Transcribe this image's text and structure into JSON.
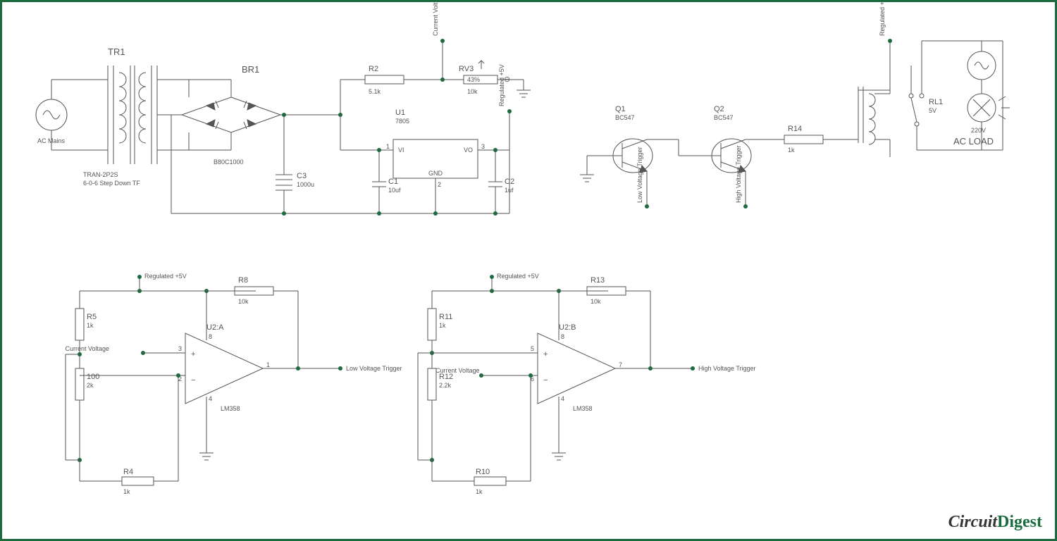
{
  "components": {
    "TR1": {
      "ref": "TR1",
      "type": "TRAN-2P2S",
      "note": "6-0-6 Step Down TF"
    },
    "AC": {
      "label": "AC Mains"
    },
    "BR1": {
      "ref": "BR1",
      "type": "B80C1000"
    },
    "C3": {
      "ref": "C3",
      "val": "1000u"
    },
    "C1": {
      "ref": "C1",
      "val": "10uf"
    },
    "C2": {
      "ref": "C2",
      "val": "1uf"
    },
    "R2": {
      "ref": "R2",
      "val": "5.1k"
    },
    "RV3": {
      "ref": "RV3",
      "val": "10k",
      "pct": "43%"
    },
    "U1": {
      "ref": "U1",
      "type": "7805",
      "pins": {
        "vi": "VI",
        "vo": "VO",
        "gnd": "GND",
        "p1": "1",
        "p2": "2",
        "p3": "3"
      }
    },
    "Q1": {
      "ref": "Q1",
      "type": "BC547"
    },
    "Q2": {
      "ref": "Q2",
      "type": "BC547"
    },
    "R14": {
      "ref": "R14",
      "val": "1k"
    },
    "RL1": {
      "ref": "RL1",
      "val": "5V"
    },
    "LOAD": {
      "label": "AC LOAD",
      "val": "220V"
    },
    "R5": {
      "ref": "R5",
      "val": "1k"
    },
    "R100": {
      "ref": "100",
      "val": "2k"
    },
    "R4": {
      "ref": "R4",
      "val": "1k"
    },
    "R8": {
      "ref": "R8",
      "val": "10k"
    },
    "U2A": {
      "ref": "U2:A",
      "type": "LM358"
    },
    "R11": {
      "ref": "R11",
      "val": "1k"
    },
    "R12": {
      "ref": "R12",
      "val": "2.2k"
    },
    "R10": {
      "ref": "R10",
      "val": "1k"
    },
    "R13": {
      "ref": "R13",
      "val": "10k"
    },
    "U2B": {
      "ref": "U2:B",
      "type": "LM358"
    }
  },
  "nets": {
    "curV": "Current Voltage",
    "reg5": "Regulated +5V",
    "lowTrig": "Low Voltage Trigger",
    "highTrig": "High Voltage Trigger"
  },
  "opamp_pins": {
    "A": {
      "p": "3",
      "n": "2",
      "out": "1",
      "vp": "8",
      "vn": "4"
    },
    "B": {
      "p": "5",
      "n": "6",
      "out": "7",
      "vp": "8",
      "vn": "4"
    }
  },
  "brand": {
    "a": "Circuit",
    "b": "Digest"
  }
}
